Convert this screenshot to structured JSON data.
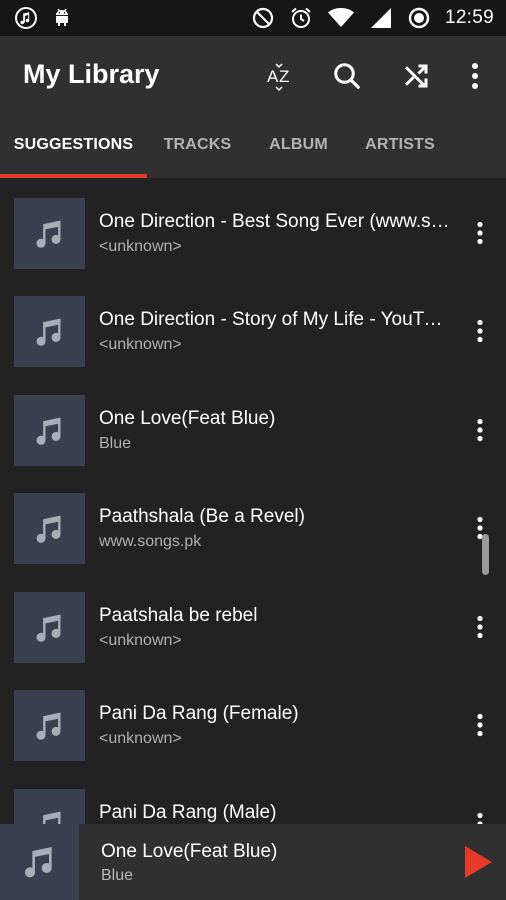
{
  "status_bar": {
    "time": "12:59",
    "left_icons": [
      "music-note-icon",
      "android-icon"
    ],
    "right_icons": [
      "do-not-disturb-icon",
      "alarm-icon",
      "wifi-icon",
      "signal-icon",
      "battery-icon"
    ]
  },
  "app_bar": {
    "title": "My Library",
    "actions": [
      "sort-az-icon",
      "search-icon",
      "shuffle-icon",
      "more-vert-icon"
    ]
  },
  "tabs": [
    {
      "label": "SUGGESTIONS",
      "active": true
    },
    {
      "label": "TRACKS",
      "active": false
    },
    {
      "label": "ALBUM",
      "active": false
    },
    {
      "label": "ARTISTS",
      "active": false
    }
  ],
  "tracks": [
    {
      "title": "One Direction - Best Song Ever (www.songs.pk)",
      "subtitle": "<unknown>"
    },
    {
      "title": "One Direction - Story of My Life - YouTube",
      "subtitle": "<unknown>"
    },
    {
      "title": "One Love(Feat Blue)",
      "subtitle": "Blue"
    },
    {
      "title": "Paathshala (Be a Revel)",
      "subtitle": "www.songs.pk"
    },
    {
      "title": "Paatshala be rebel",
      "subtitle": "<unknown>"
    },
    {
      "title": "Pani Da Rang (Female)",
      "subtitle": "<unknown>"
    },
    {
      "title": "Pani Da Rang (Male)",
      "subtitle": ""
    }
  ],
  "now_playing": {
    "title": "One Love(Feat Blue)",
    "artist": "Blue",
    "play_icon": "play-icon"
  },
  "colors": {
    "accent": "#e53a28",
    "app_bar": "#303030",
    "background": "#222222",
    "thumbnail": "#3b4050"
  }
}
